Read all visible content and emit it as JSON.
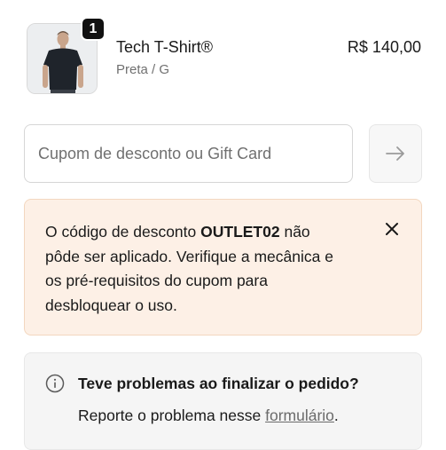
{
  "product": {
    "quantity": "1",
    "name": "Tech T-Shirt®",
    "variant": "Preta / G",
    "price": "R$ 140,00"
  },
  "coupon": {
    "placeholder": "Cupom de desconto ou Gift Card",
    "value": ""
  },
  "error": {
    "text_before": "O código de desconto ",
    "code": "OUTLET02",
    "text_after": " não pôde ser aplicado. Verifique a mecânica e os pré-requisitos do cupom para desbloquear o uso."
  },
  "help": {
    "title": "Teve problemas ao finalizar o pedido?",
    "text_before": "Reporte o problema nesse ",
    "link_label": "formulário",
    "text_after": "."
  },
  "colors": {
    "error_bg": "#fdf0e6",
    "error_border": "#f3d7bf",
    "help_bg": "#f5f5f5",
    "badge_bg": "#111111"
  },
  "icons": {
    "apply": "arrow-right-icon",
    "close": "close-icon",
    "help": "info-icon"
  }
}
